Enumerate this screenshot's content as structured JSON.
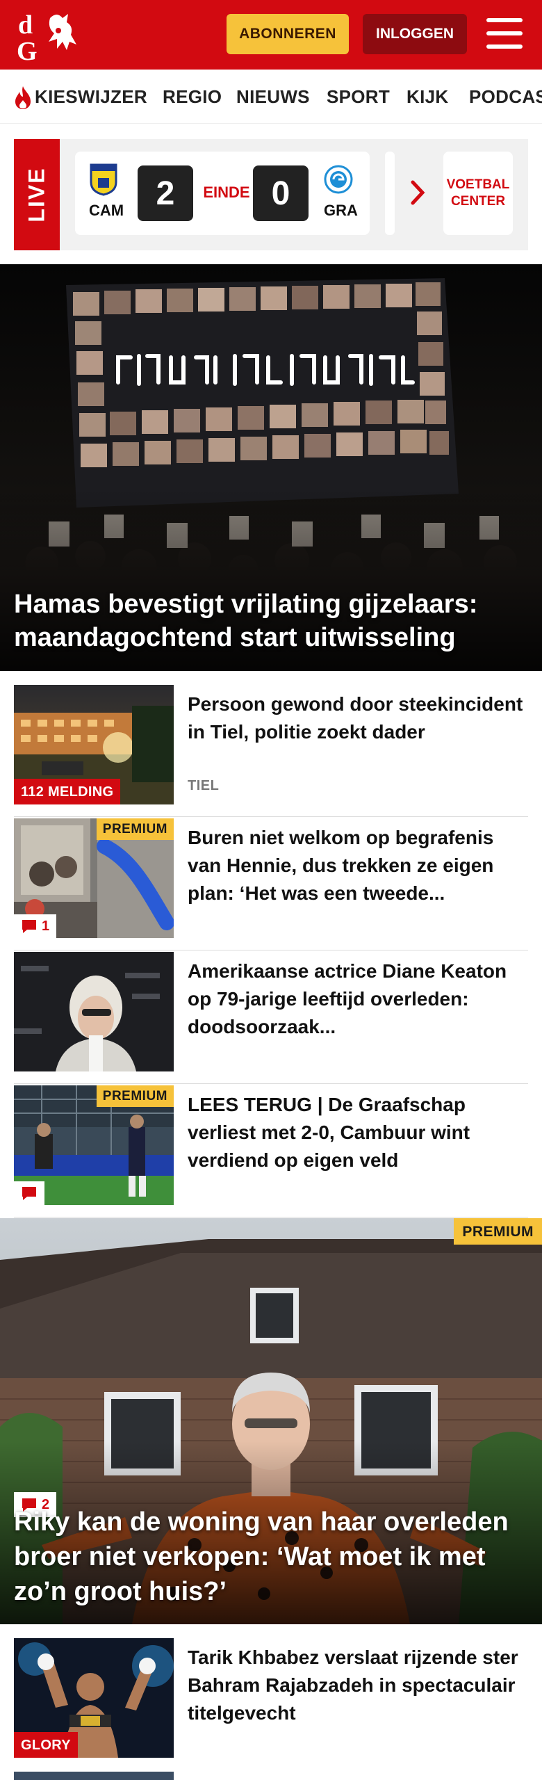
{
  "header": {
    "subscribe_label": "ABONNEREN",
    "login_label": "INLOGGEN",
    "brand_color": "#d20a11"
  },
  "nav": {
    "items": [
      "KIESWIJZER",
      "REGIO",
      "NIEUWS",
      "SPORT",
      "KIJK",
      "PODCAS"
    ]
  },
  "live": {
    "label": "LIVE",
    "match": {
      "home": "CAM",
      "away": "GRA",
      "home_score": "2",
      "away_score": "0",
      "status": "EINDE"
    },
    "cta": "VOETBAL CENTER"
  },
  "hero": {
    "title": "Hamas bevestigt vrijlating gijzelaars: maandagochtend start uitwisseling"
  },
  "articles": [
    {
      "title": "Persoon gewond door steekinci­dent in Tiel, politie zoekt dader",
      "tag": "112 MELDING",
      "location": "TIEL"
    },
    {
      "title": "Buren niet welkom op begrafenis van Hennie, dus trekken ze eigen plan: ‘Het was een tweede...",
      "premium": "PREMIUM",
      "comments": "1"
    },
    {
      "title": "Amerikaanse actrice Diane Keaton op 79-jarige leeftijd overleden: doodsoorzaak..."
    },
    {
      "title": "LEES TERUG | De Graafschap verliest met 2-0, Cambuur wint verdiend op eigen veld",
      "premium": "PREMIUM"
    }
  ],
  "feature": {
    "title": "Riky kan de woning van haar overleden broer niet verkopen: ‘Wat moet ik met zo’n groot huis?’",
    "premium": "PREMIUM",
    "comments": "2"
  },
  "article_bottom": {
    "title": "Tarik Khbabez verslaat rijzende ster Bahram Rajabzadeh in spectaculair titelgevecht",
    "tag": "GLORY"
  }
}
